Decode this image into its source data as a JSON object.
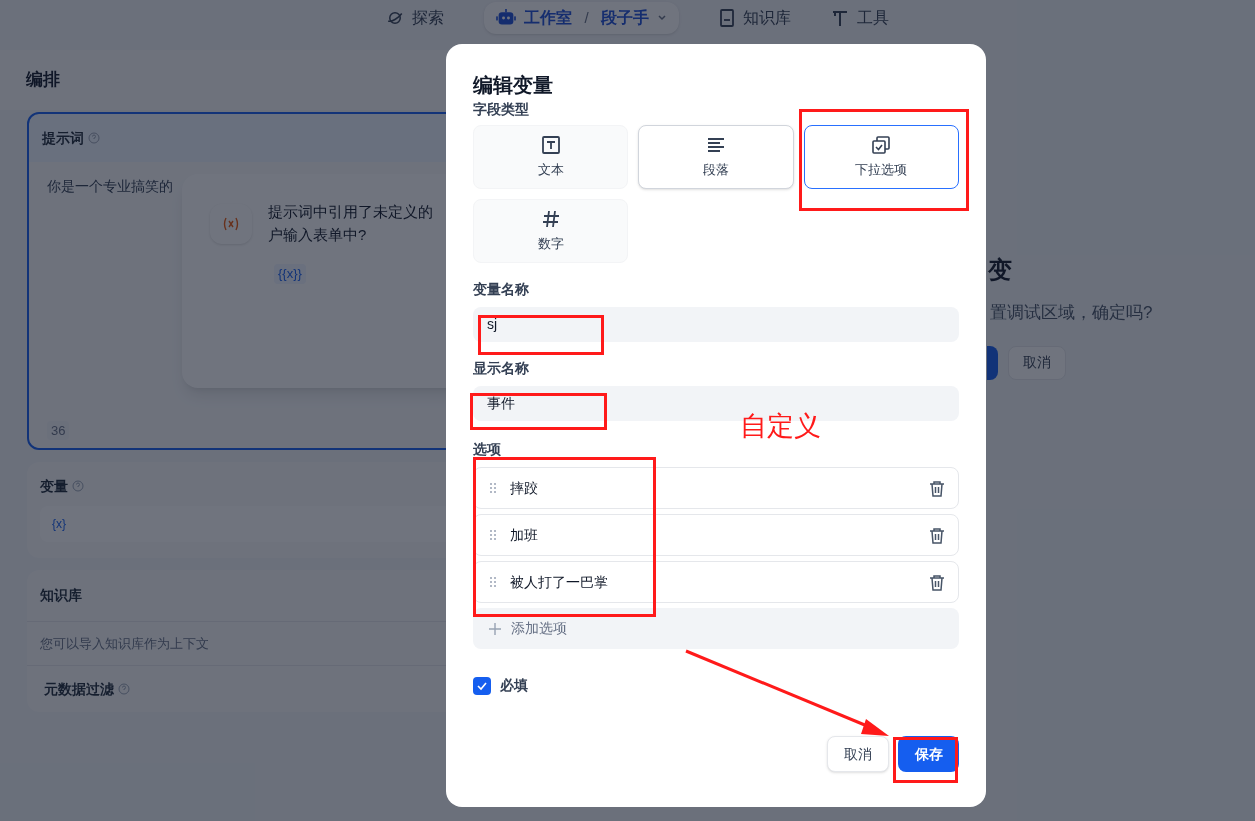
{
  "top_nav": {
    "items": [
      {
        "kind": "explore",
        "label": "探索"
      },
      {
        "kind": "studio",
        "label": "工作室",
        "separator": "/",
        "app": "段子手"
      },
      {
        "kind": "knowledge",
        "label": "知识库"
      },
      {
        "kind": "tools",
        "label": "工具"
      }
    ]
  },
  "background": {
    "section_title": "编排",
    "prompt": {
      "title": "提示词",
      "text": "你是一个专业搞笑的",
      "count": "36",
      "popup": {
        "lines": [
          "提示词中引用了未定义的",
          "户输入表单中?"
        ],
        "tag": "{{x}}"
      }
    },
    "variables": {
      "title": "变量",
      "chip": "{x}"
    },
    "knowledge": {
      "title": "知识库",
      "hint": "您可以导入知识库作为上下文",
      "filter": "元数据过滤"
    },
    "confirm": {
      "title": "变",
      "message": "置调试区域，确定吗?",
      "cancel": "取消"
    }
  },
  "dialog": {
    "title": "编辑变量",
    "field_type_label": "字段类型",
    "field_types": [
      {
        "kind": "text",
        "label": "文本",
        "selected": false,
        "hovered": false
      },
      {
        "kind": "paragraph",
        "label": "段落",
        "selected": false,
        "hovered": true
      },
      {
        "kind": "select",
        "label": "下拉选项",
        "selected": true,
        "hovered": false
      },
      {
        "kind": "number",
        "label": "数字",
        "selected": false,
        "hovered": false
      }
    ],
    "variable_name": {
      "label": "变量名称",
      "value": "sj"
    },
    "display_name": {
      "label": "显示名称",
      "value": "事件"
    },
    "options_label": "选项",
    "options": [
      "摔跤",
      "加班",
      "被人打了一巴掌"
    ],
    "add_option": "添加选项",
    "required": {
      "label": "必填",
      "checked": true
    },
    "buttons": {
      "cancel": "取消",
      "save": "保存"
    }
  },
  "annotation": {
    "note": "自定义"
  }
}
